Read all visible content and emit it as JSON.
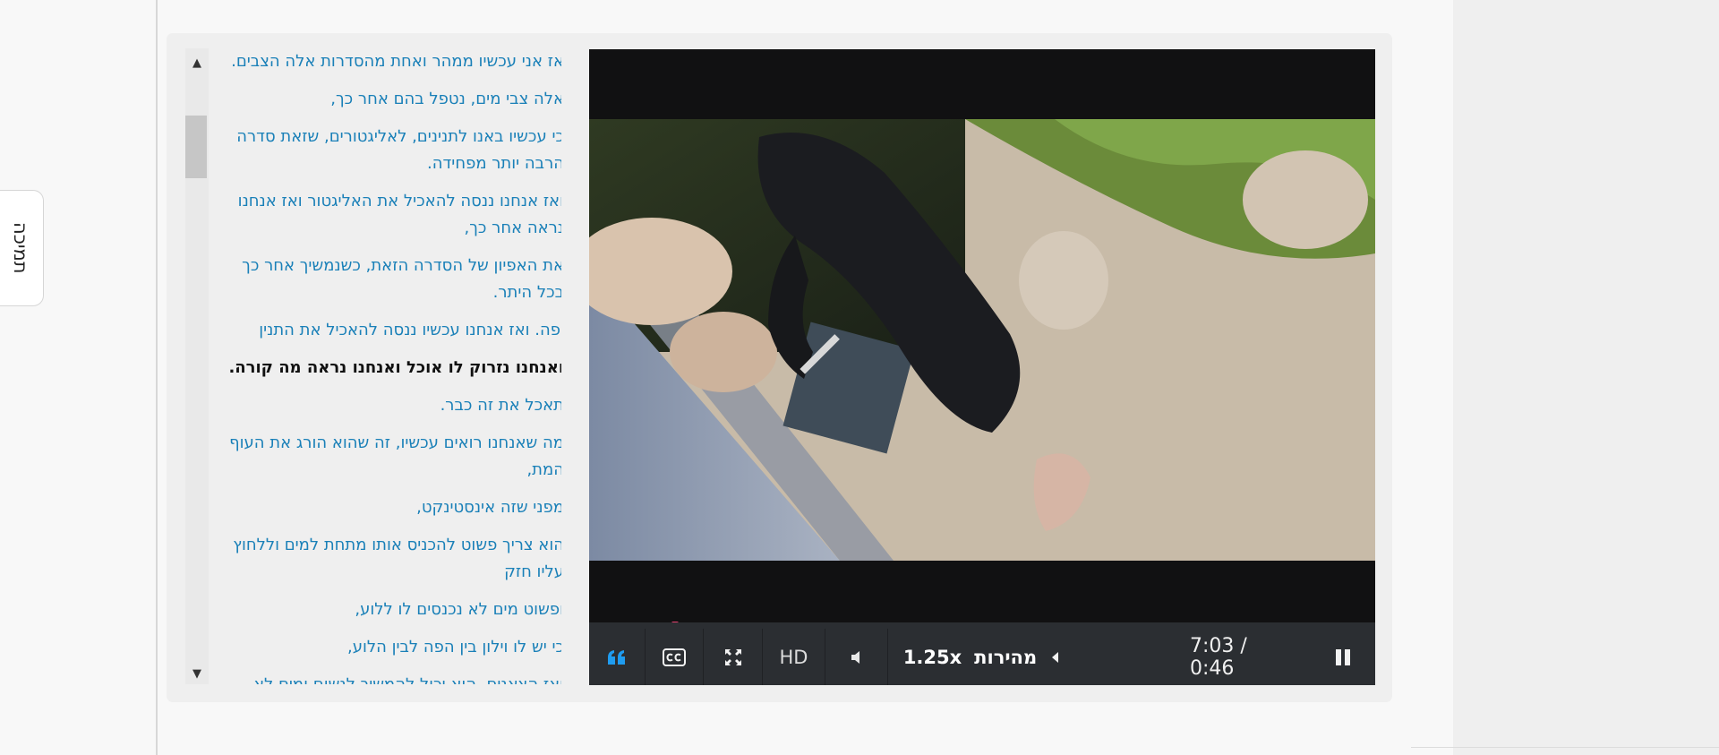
{
  "support_tab": {
    "label": "תמיכה"
  },
  "transcript": {
    "lines": [
      "אז אני עכשיו ממהר ואחת מהסדרות אלה הצבים.",
      "אלה צבי מים, נטפל בהם אחר כך,",
      "כי עכשיו באנו לתנינים, לאליגטורים, שזאת סדרה הרבה יותר מפחידה.",
      "ואז אנחנו ננסה להאכיל את האליגטור ואז אנחנו נראה אחר כך,",
      "את האפיון של הסדרה הזאת, כשנמשיך אחר כך בכל היתר.",
      "יפה. ואז אנחנו עכשיו ננסה להאכיל את התנין",
      "ואנחנו נזרוק לו אוכל ואנחנו נראה מה קורה.",
      "תאכל את זה כבר.",
      "מה שאנחנו רואים עכשיו, זה שהוא הורג את העוף המת,",
      "מפני שזה אינסטינקט,",
      "הוא צריך פשוט להכניס אותו מתחת למים וללחוץ עליו חזק",
      "ופשוט מים לא נכנסים לו ללוע,",
      "כי יש לו וילון בין הפה לבין הלוע,",
      "ואז הצאנים, הוא יכול להמשיך לנשום ומים לא"
    ],
    "active_index": 6
  },
  "player": {
    "time": "7:03 / 0:46",
    "speed_label": "מהירות",
    "speed_value": "1.25x",
    "hd_label": "HD",
    "progress_fraction": 0.109,
    "icons": [
      "pause-icon",
      "speed-left-arrow-icon",
      "volume-icon",
      "fullscreen-icon",
      "cc-icon",
      "quote-icon"
    ]
  },
  "colors": {
    "link": "#1a80b8",
    "progress": "#c13b61",
    "controls_bg": "#2b2e32",
    "quote_icon": "#1f9cf0"
  }
}
